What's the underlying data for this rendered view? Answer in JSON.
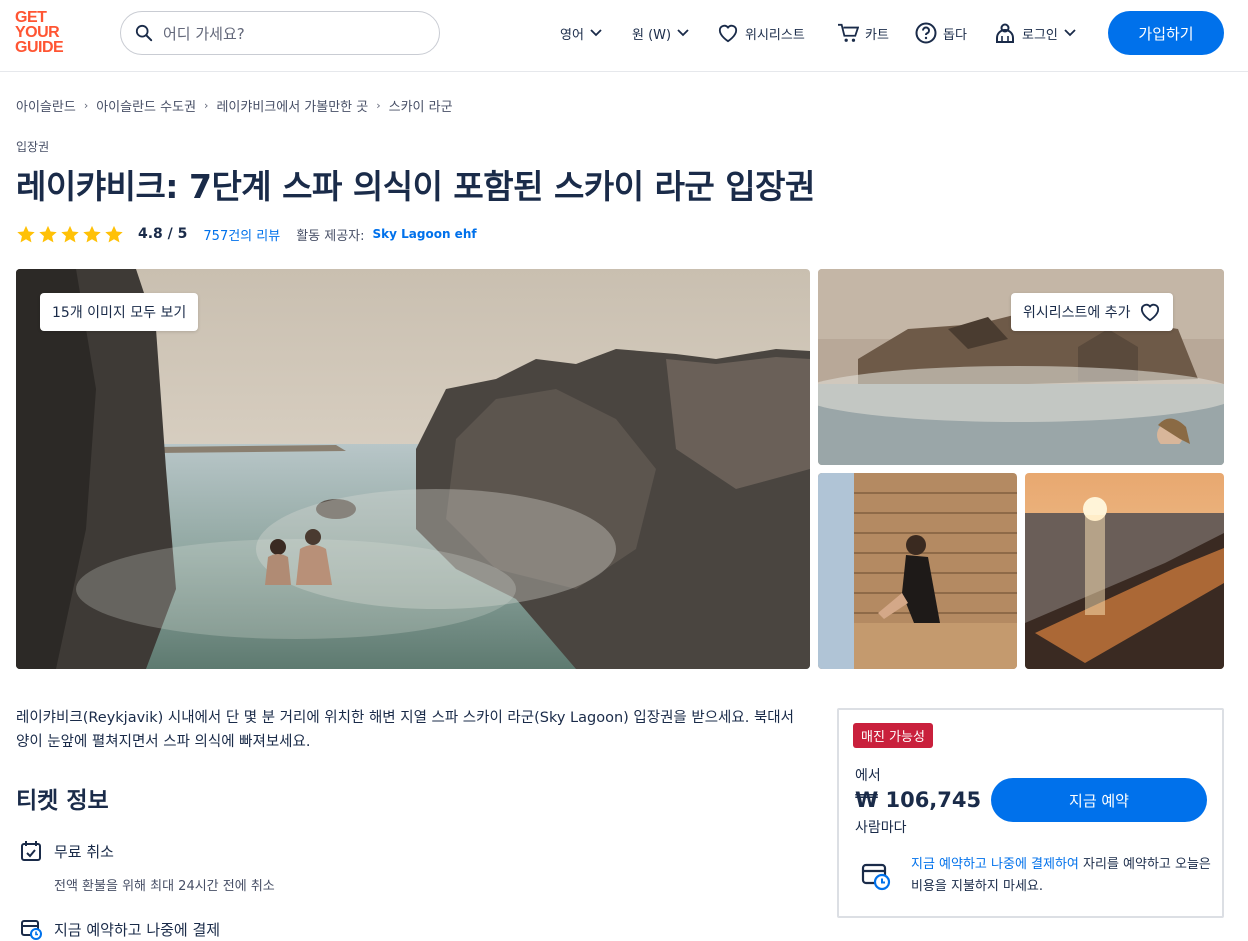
{
  "header": {
    "logo": [
      "GET",
      "YOUR",
      "GUIDE"
    ],
    "search_placeholder": "어디 가세요?",
    "language": "영어",
    "currency": "원 (W)",
    "wishlist": "위시리스트",
    "cart": "카트",
    "help": "돕다",
    "login": "로그인",
    "signup": "가입하기"
  },
  "breadcrumb": [
    "아이슬란드",
    "아이슬란드 수도권",
    "레이캬비크에서 가볼만한 곳",
    "스카이 라군"
  ],
  "category": "입장권",
  "title": "레이캬비크: 7단계 스파 의식이 포함된 스카이 라군 입장권",
  "rating": {
    "value": "4.8 / 5",
    "stars": 5,
    "reviews": "757건의 리뷰",
    "provider_label": "활동 제공자:",
    "provider": "Sky Lagoon ehf"
  },
  "gallery": {
    "all_images": "15개 이미지 모두 보기",
    "add_wishlist": "위시리스트에 추가"
  },
  "description": "레이캬비크(Reykjavik) 시내에서 단 몇 분 거리에 위치한 해변 지열 스파 스카이 라군(Sky Lagoon) 입장권을 받으세요. 북대서양이 눈앞에 펼쳐지면서 스파 의식에 빠져보세요.",
  "ticket_info": {
    "heading": "티켓 정보",
    "features": [
      {
        "title": "무료 취소",
        "sub": "전액 환불을 위해 최대 24시간 전에 취소"
      },
      {
        "title": "지금 예약하고 나중에 결제",
        "sub": ""
      }
    ]
  },
  "booking": {
    "badge": "매진 가능성",
    "from": "에서",
    "price": "₩ 106,745",
    "per": "사람마다",
    "button": "지금 예약",
    "note_link": "지금 예약하고 나중에 결제하여",
    "note_rest": " 자리를 예약하고 오늘은 비용을 지불하지 마세요."
  },
  "colors": {
    "brand": "#ff5533",
    "primary": "#0071eb",
    "badge": "#c9203c",
    "star": "#ffc107"
  }
}
